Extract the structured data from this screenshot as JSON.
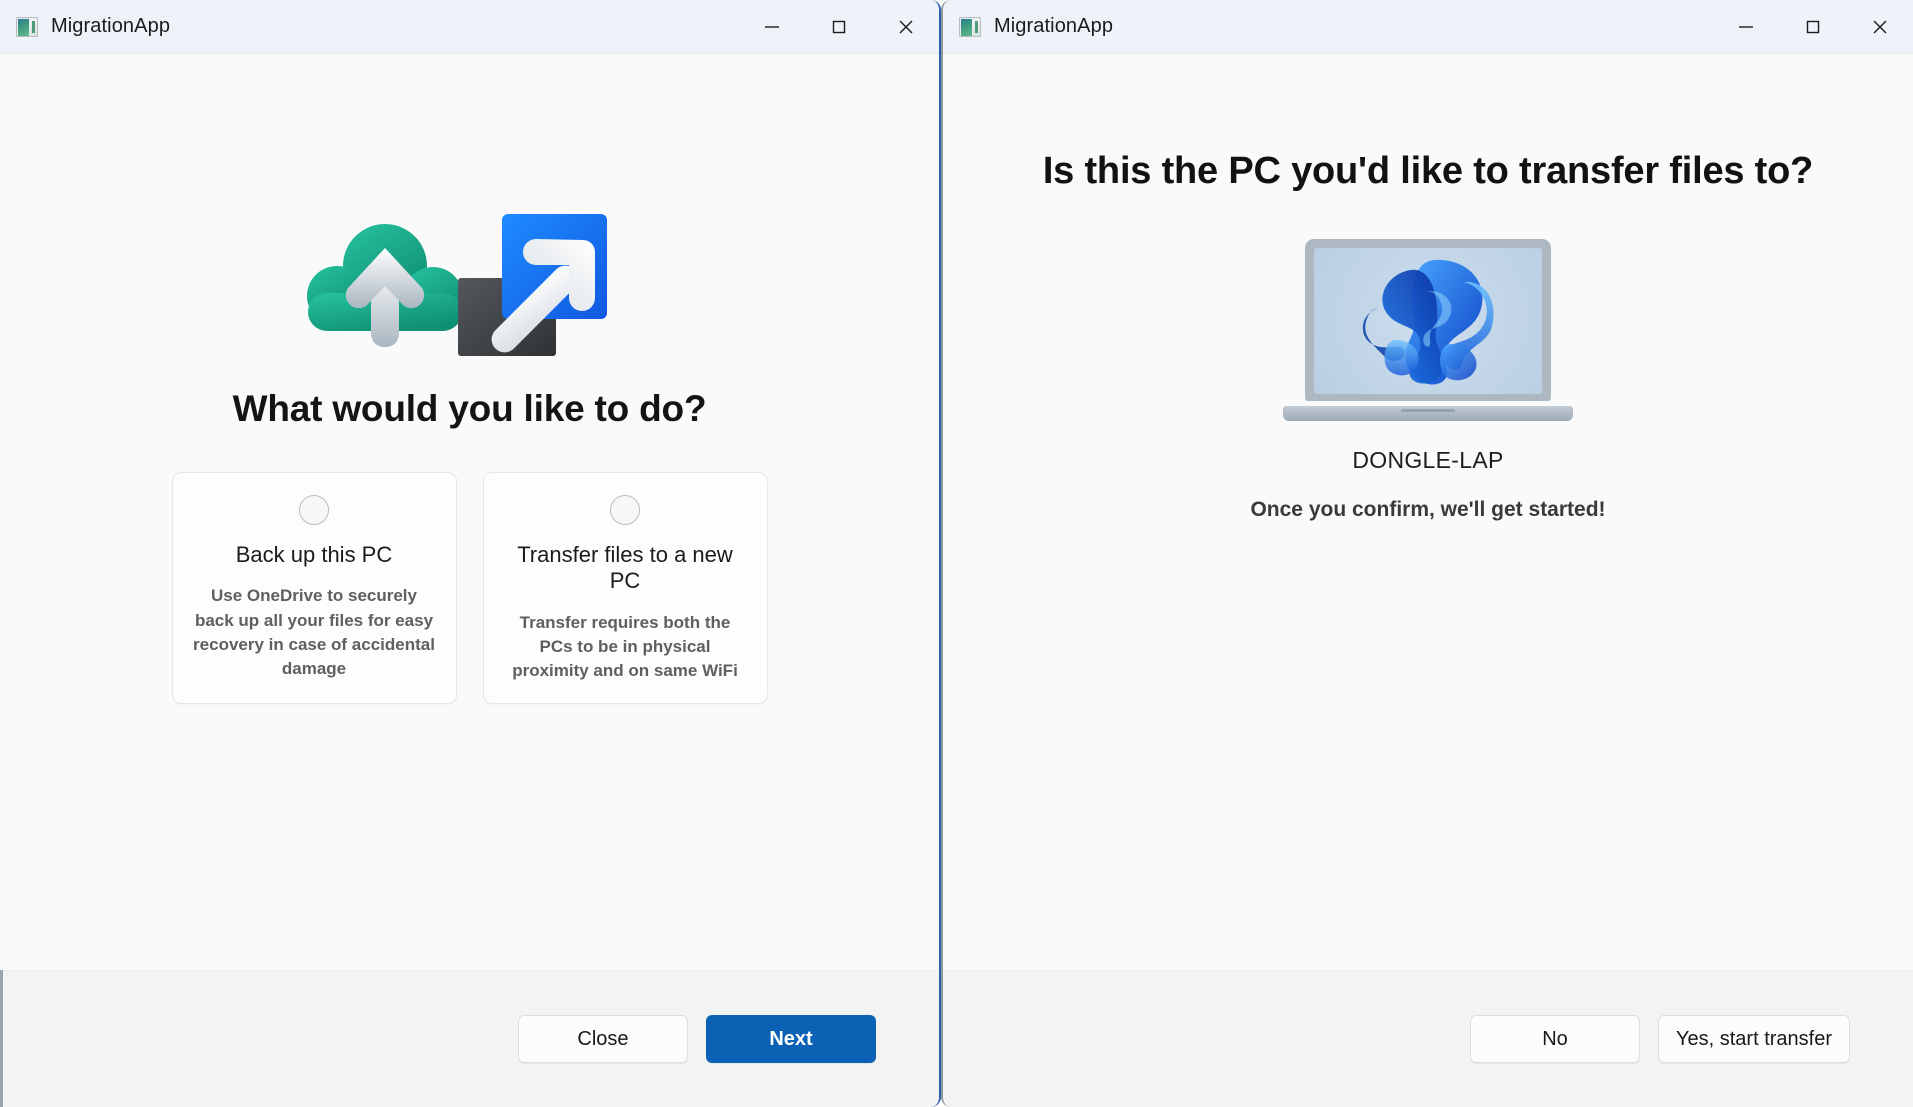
{
  "left_window": {
    "titlebar": {
      "app_icon": "app-window-icon",
      "title": "MigrationApp",
      "controls": {
        "minimize": "minimize-icon",
        "maximize": "maximize-icon",
        "close": "close-icon"
      }
    },
    "badge": "window-snap-badge",
    "hero_icon": "cloud-upload-and-transfer-icon",
    "page_title": "What would you like to do?",
    "options": [
      {
        "radio": "radio-unselected",
        "title": "Back up this PC",
        "description": "Use OneDrive to securely back up all your files for easy recovery in case of accidental damage"
      },
      {
        "radio": "radio-unselected",
        "title": "Transfer files to a new PC",
        "description": "Transfer requires both the PCs to be in physical proximity and on same WiFi"
      }
    ],
    "footer": {
      "secondary_label": "Close",
      "primary_label": "Next"
    }
  },
  "right_window": {
    "titlebar": {
      "app_icon": "app-window-icon",
      "title": "MigrationApp",
      "controls": {
        "minimize": "minimize-icon",
        "maximize": "maximize-icon",
        "close": "close-icon"
      }
    },
    "badge": "window-snap-badge",
    "page_title": "Is this the PC you'd like to transfer files to?",
    "device_image": "laptop-with-windows-wallpaper",
    "device_name": "DONGLE-LAP",
    "device_subtitle": "Once you confirm, we'll get started!",
    "footer": {
      "decline_label": "No",
      "confirm_label": "Yes, start transfer"
    }
  },
  "colors": {
    "primary_button": "#0b62b5",
    "titlebar": "#eef3f9",
    "footer": "#f3f3f3",
    "window_body": "#fafafa",
    "focus_border": "#2b5fa8",
    "badge_border": "#3c4673",
    "badge_fill": "#ccd4ee"
  }
}
